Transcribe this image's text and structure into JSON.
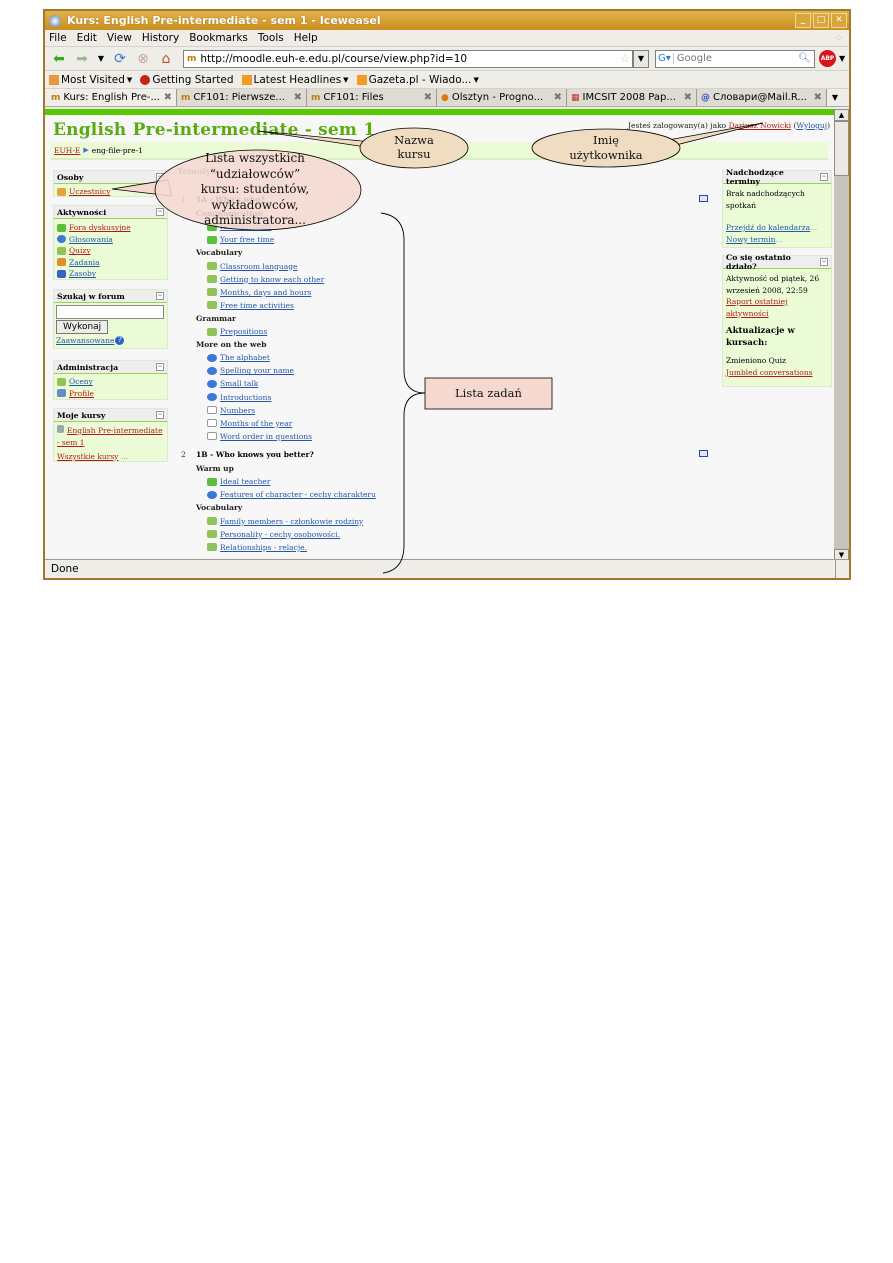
{
  "window": {
    "title": "Kurs: English Pre-intermediate - sem 1 - Iceweasel",
    "controls": [
      "minimize",
      "maximize",
      "close"
    ]
  },
  "menubar": [
    "File",
    "Edit",
    "View",
    "History",
    "Bookmarks",
    "Tools",
    "Help"
  ],
  "navigation": {
    "url": "http://moodle.euh-e.edu.pl/course/view.php?id=10",
    "search_placeholder": "Google"
  },
  "bookmarks": [
    {
      "label": "Most Visited",
      "has_dropdown": true,
      "icon": "most-visited-icon"
    },
    {
      "label": "Getting Started",
      "has_dropdown": false,
      "icon": "getting-started-icon"
    },
    {
      "label": "Latest Headlines",
      "has_dropdown": true,
      "icon": "rss-icon"
    },
    {
      "label": "Gazeta.pl - Wiado...",
      "has_dropdown": true,
      "icon": "rss-icon"
    }
  ],
  "tabs": [
    {
      "label": "Kurs: English Pre-...",
      "active": true,
      "icon": "moodle-icon"
    },
    {
      "label": "CF101: Pierwsze...",
      "active": false,
      "icon": "moodle-icon"
    },
    {
      "label": "CF101: Files",
      "active": false,
      "icon": "moodle-icon"
    },
    {
      "label": "Olsztyn - Progno...",
      "active": false,
      "icon": "weather-icon"
    },
    {
      "label": "IMCSIT 2008 Pap...",
      "active": false,
      "icon": "imcsit-icon"
    },
    {
      "label": "Словари@Mail.R...",
      "active": false,
      "icon": "mail-ru-icon"
    }
  ],
  "status": "Done",
  "page": {
    "title": "English Pre-intermediate - sem 1",
    "login": {
      "prefix": "Jesteś zalogowany(a) jako",
      "user": "Dariusz Nowicki",
      "logout": "Wyloguj"
    },
    "breadcrumb": {
      "home": "EUH-E",
      "current": "eng-file-pre-1"
    },
    "left_blocks": {
      "osoby": {
        "title": "Osoby",
        "items": [
          "Uczestnicy"
        ]
      },
      "aktywnosci": {
        "title": "Aktywności",
        "items": [
          "Fora dyskusyjne",
          "Głosowania",
          "Quizy",
          "Zadania",
          "Zasoby"
        ]
      },
      "szukaj": {
        "title": "Szukaj w forum",
        "button": "Wykonaj",
        "advanced": "Zaawansowane",
        "input_value": ""
      },
      "administracja": {
        "title": "Administracja",
        "items": [
          "Oceny",
          "Profile"
        ]
      },
      "moje_kursy": {
        "title": "Moje kursy",
        "course": "English Pre-intermediate - sem 1",
        "course_line1": "English Pre-intermediate",
        "course_line2": "- sem 1",
        "all": "Wszystkie kursy",
        "all_suffix": "..."
      }
    },
    "topics_heading": "Tematyka",
    "sections": [
      {
        "number": "1",
        "title": "1A - Who's who?",
        "groups": [
          {
            "label": "Communication",
            "items": [
              {
                "text": "Introductions",
                "type": "forum"
              },
              {
                "text": "Your free time",
                "type": "forum"
              }
            ]
          },
          {
            "label": "Vocabulary",
            "items": [
              {
                "text": "Classroom language",
                "type": "quiz"
              },
              {
                "text": "Getting to know each other",
                "type": "quiz"
              },
              {
                "text": "Months, days and hours",
                "type": "quiz"
              },
              {
                "text": "Free time activities",
                "type": "quiz"
              }
            ]
          },
          {
            "label": "Grammar",
            "items": [
              {
                "text": "Prepositions",
                "type": "quiz"
              }
            ]
          },
          {
            "label": "More on the web",
            "items": [
              {
                "text": "The alphabet",
                "type": "web"
              },
              {
                "text": "Spelling your name",
                "type": "web"
              },
              {
                "text": "Small talk",
                "type": "web"
              },
              {
                "text": "Introductions",
                "type": "web"
              },
              {
                "text": "Numbers",
                "type": "file"
              },
              {
                "text": "Months of the year",
                "type": "file"
              },
              {
                "text": "Word order in questions",
                "type": "file"
              }
            ]
          }
        ]
      },
      {
        "number": "2",
        "title": "1B - Who knows you better?",
        "groups": [
          {
            "label": "Warm up",
            "items": [
              {
                "text": "Ideal teacher",
                "type": "forum"
              },
              {
                "text": "Features of character - cechy charakteru",
                "type": "poll"
              }
            ]
          },
          {
            "label": "Vocabulary",
            "items": [
              {
                "text": "Family members - członkowie rodziny",
                "type": "quiz"
              },
              {
                "text": "Personality - cechy osobowości.",
                "type": "quiz"
              },
              {
                "text": "Relationships - relacje.",
                "type": "quiz"
              }
            ]
          }
        ]
      }
    ],
    "right_blocks": {
      "terminy": {
        "title": "Nadchodzące terminy",
        "text": "Brak nadchodzących spotkań",
        "links": [
          "Przejdź do kalendarza",
          "Nowy termin"
        ],
        "suffix": "..."
      },
      "ostatnio": {
        "title": "Co się ostatnio działo?",
        "activity": "Aktywność od piątek, 26 wrzesień 2008, 22:59",
        "report": "Raport ostatniej aktywności",
        "updates_heading": "Aktualizacje w kursach:",
        "changed": "Zmieniono Quiz",
        "changed_link": "Jumbled conversations"
      }
    }
  },
  "annotations": {
    "course_name": {
      "line1": "Nazwa",
      "line2": "kursu"
    },
    "user_name": {
      "line1": "Imię",
      "line2": "użytkownika"
    },
    "participants": {
      "line1": "Lista wszystkich",
      "line2": "“udziałowców”",
      "line3": "kursu: studentów,",
      "line4": "wykładowców,",
      "line5": "administratora..."
    },
    "task_list": "Lista zadań"
  },
  "colors": {
    "moodle_green": "#5aab0e",
    "link_red": "#b31b1b",
    "link_blue": "#2558a7",
    "block_bg": "#ebfbd6",
    "callout_fill": "#f5d9d0",
    "window_frame": "#c98f20"
  }
}
